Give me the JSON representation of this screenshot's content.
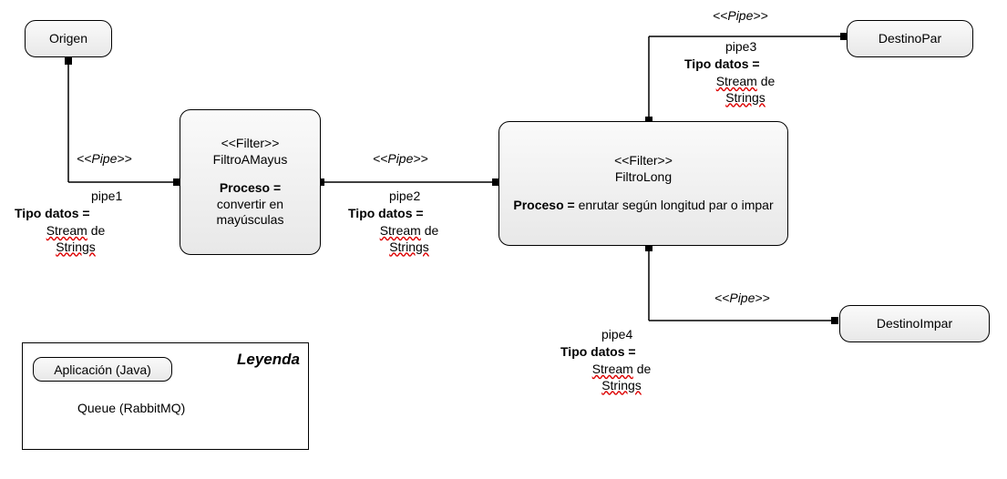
{
  "nodes": {
    "origen": {
      "label": "Origen"
    },
    "filtroAMayus": {
      "stereotype": "<<Filter>>",
      "name": "FiltroAMayus",
      "process_label": "Proceso =",
      "process_desc": "convertir en mayúsculas"
    },
    "filtroLong": {
      "stereotype": "<<Filter>>",
      "name": "FiltroLong",
      "process_label": "Proceso =",
      "process_desc": "enrutar según longitud par o impar"
    },
    "destinoPar": {
      "label": "DestinoPar"
    },
    "destinoImpar": {
      "label": "DestinoImpar"
    }
  },
  "pipes": {
    "pipe1": {
      "stereotype": "<<Pipe>>",
      "name": "pipe1",
      "tipo_label": "Tipo datos =",
      "tipo_value_p1": "Stream",
      "tipo_value_p2": " de",
      "tipo_value_p3": "Strings"
    },
    "pipe2": {
      "stereotype": "<<Pipe>>",
      "name": "pipe2",
      "tipo_label": "Tipo datos =",
      "tipo_value_p1": "Stream",
      "tipo_value_p2": " de",
      "tipo_value_p3": "Strings"
    },
    "pipe3": {
      "stereotype": "<<Pipe>>",
      "name": "pipe3",
      "tipo_label": "Tipo datos =",
      "tipo_value_p1": "Stream",
      "tipo_value_p2": " de",
      "tipo_value_p3": "Strings"
    },
    "pipe4": {
      "stereotype": "<<Pipe>>",
      "name": "pipe4",
      "tipo_label": "Tipo datos =",
      "tipo_value_p1": "Stream",
      "tipo_value_p2": " de",
      "tipo_value_p3": "Strings"
    }
  },
  "legend": {
    "title": "Leyenda",
    "app": "Aplicación (Java)",
    "queue": "Queue (RabbitMQ)"
  }
}
